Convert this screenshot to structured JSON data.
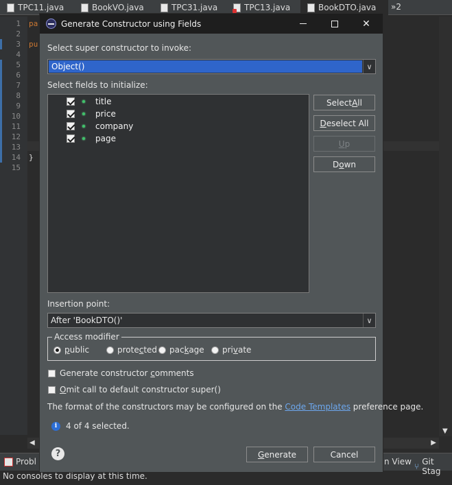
{
  "ide": {
    "tabs": [
      {
        "label": "TPC11.java",
        "error": false
      },
      {
        "label": "BookVO.java",
        "error": false
      },
      {
        "label": "TPC31.java",
        "error": false
      },
      {
        "label": "TPC13.java",
        "error": true
      },
      {
        "label": "BookDTO.java",
        "active": true,
        "error": false
      }
    ],
    "overflow_label": "»2",
    "line_numbers": [
      "1",
      "2",
      "3",
      "4",
      "5",
      "6",
      "7",
      "8",
      "9",
      "10",
      "11",
      "12",
      "13",
      "14",
      "15"
    ],
    "code_snippets": {
      "line1": "pa",
      "line3": "pu",
      "line14": "}"
    },
    "bottom_tabs": {
      "problems": "Probl",
      "view": "n View",
      "git": "Git Stag"
    },
    "console_message": "No consoles to display at this time."
  },
  "dialog": {
    "title": "Generate Constructor using Fields",
    "super_label": "Select super constructor to invoke:",
    "super_value": "Object()",
    "fields_label": "Select fields to initialize:",
    "fields": [
      {
        "name": "title",
        "checked": true
      },
      {
        "name": "price",
        "checked": true
      },
      {
        "name": "company",
        "checked": true
      },
      {
        "name": "page",
        "checked": true
      }
    ],
    "side_buttons": {
      "select_all": {
        "pre": "Select ",
        "ul": "A",
        "post": "ll"
      },
      "deselect_all": {
        "pre": "",
        "ul": "D",
        "post": "eselect All"
      },
      "up": {
        "pre": "",
        "ul": "U",
        "post": "p"
      },
      "down": {
        "pre": "D",
        "ul": "o",
        "post": "wn"
      }
    },
    "insertion_label": "Insertion point:",
    "insertion_value": "After 'BookDTO()'",
    "access_modifier": {
      "legend": "Access modifier",
      "options": [
        {
          "pre": "",
          "ul": "p",
          "post": "ublic",
          "selected": true
        },
        {
          "pre": "prote",
          "ul": "c",
          "post": "ted",
          "selected": false
        },
        {
          "pre": "pac",
          "ul": "k",
          "post": "age",
          "selected": false
        },
        {
          "pre": "pri",
          "ul": "v",
          "post": "ate",
          "selected": false
        }
      ]
    },
    "generate_comments": {
      "pre": "Generate constructor ",
      "ul": "c",
      "post": "omments",
      "checked": false
    },
    "omit_super": {
      "pre": "",
      "ul": "O",
      "post": "mit call to default constructor super()",
      "checked": false
    },
    "info_pre": "The format of the constructors may be configured on the ",
    "info_link": "Code Templates",
    "info_post": " preference page.",
    "status": "4 of 4 selected.",
    "generate": {
      "pre": "",
      "ul": "G",
      "post": "enerate"
    },
    "cancel": "Cancel"
  }
}
